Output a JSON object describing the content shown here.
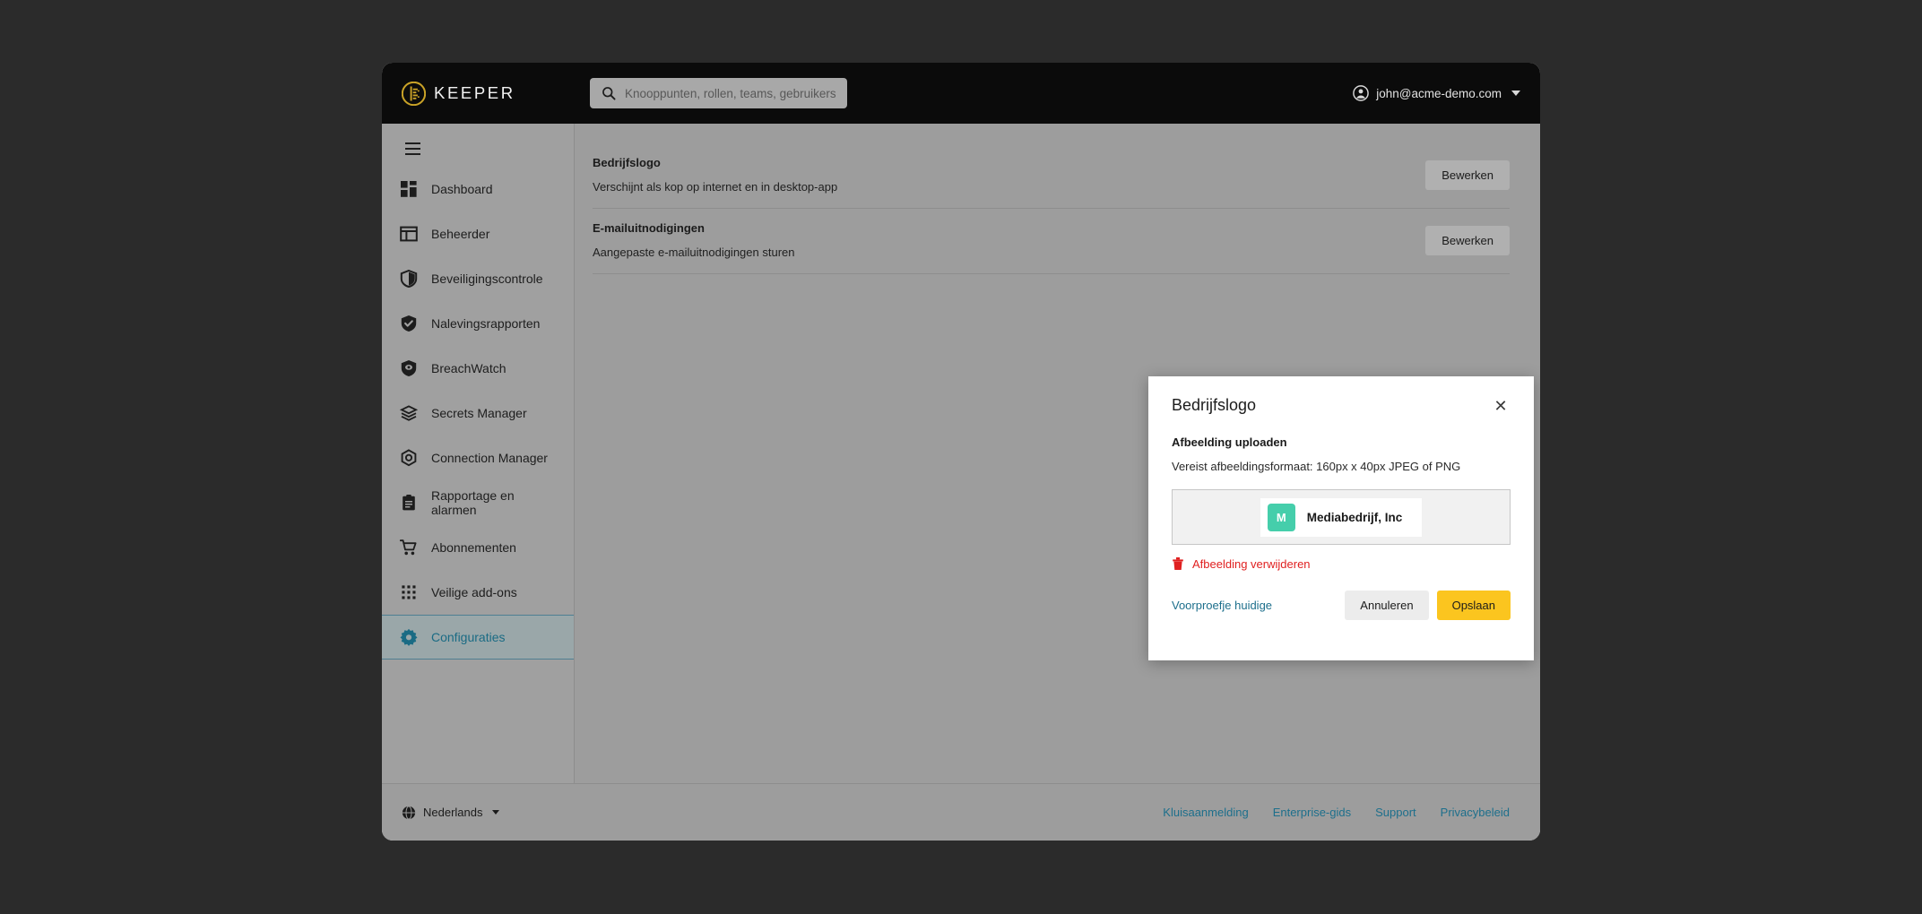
{
  "topbar": {
    "brand_name": "KEEPER",
    "search": {
      "placeholder": "Knooppunten, rollen, teams, gebruikers",
      "value": ""
    },
    "user_email": "john@acme-demo.com"
  },
  "sidebar": {
    "items": [
      {
        "label": "Dashboard",
        "icon": "dashboard-icon",
        "active": false
      },
      {
        "label": "Beheerder",
        "icon": "admin-panel-icon",
        "active": false
      },
      {
        "label": "Beveiligingscontrole",
        "icon": "shield-half-icon",
        "active": false
      },
      {
        "label": "Nalevingsrapporten",
        "icon": "shield-check-icon",
        "active": false
      },
      {
        "label": "BreachWatch",
        "icon": "shield-eye-icon",
        "active": false
      },
      {
        "label": "Secrets Manager",
        "icon": "layers-icon",
        "active": false
      },
      {
        "label": "Connection Manager",
        "icon": "hexagon-node-icon",
        "active": false
      },
      {
        "label": "Rapportage en alarmen",
        "icon": "clipboard-icon",
        "active": false
      },
      {
        "label": "Abonnementen",
        "icon": "shopping-cart-icon",
        "active": false
      },
      {
        "label": "Veilige add-ons",
        "icon": "grid-dots-icon",
        "active": false
      },
      {
        "label": "Configuraties",
        "icon": "gear-icon",
        "active": true
      }
    ]
  },
  "main": {
    "settings": [
      {
        "title": "Bedrijfslogo",
        "description": "Verschijnt als kop op internet en in desktop-app",
        "action_label": "Bewerken"
      },
      {
        "title": "E-mailuitnodigingen",
        "description": "Aangepaste e-mailuitnodigingen sturen",
        "action_label": "Bewerken"
      }
    ]
  },
  "modal": {
    "title": "Bedrijfslogo",
    "close_label": "✕",
    "upload_label": "Afbeelding uploaden",
    "upload_hint": "Vereist afbeeldingsformaat: 160px x 40px JPEG of PNG",
    "preview": {
      "initial": "M",
      "company_name": "Mediabedrijf, Inc",
      "tile_color": "#45ceab"
    },
    "remove_label": "Afbeelding verwijderen",
    "remove_color": "#e02020",
    "preview_link_label": "Voorproefje huidige",
    "cancel_label": "Annuleren",
    "save_label": "Opslaan",
    "save_color": "#fbc51f"
  },
  "footer": {
    "language": "Nederlands",
    "links": [
      {
        "label": "Kluisaanmelding"
      },
      {
        "label": "Enterprise-gids"
      },
      {
        "label": "Support"
      },
      {
        "label": "Privacybeleid"
      }
    ],
    "link_color": "#1d6f8c"
  }
}
